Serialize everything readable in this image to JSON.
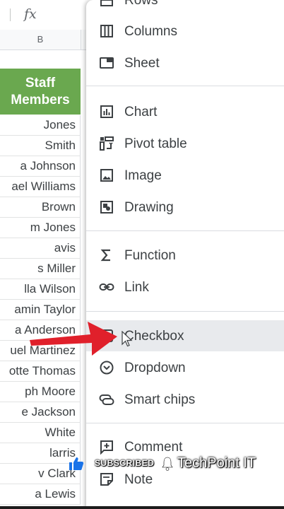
{
  "spreadsheet": {
    "column_header": "B",
    "header_cell": {
      "line1": "Staff",
      "line2": "Members"
    },
    "rows": [
      "Jones",
      "Smith",
      "a Johnson",
      "ael Williams",
      "Brown",
      "m Jones",
      "avis",
      "s Miller",
      "lla Wilson",
      "amin Taylor",
      "a Anderson",
      "uel Martinez",
      "otte Thomas",
      "ph Moore",
      "e Jackson",
      "White",
      "larris",
      "v Clark",
      "a Lewis"
    ],
    "header_color": "#6aa84f"
  },
  "menu": {
    "items": [
      {
        "label": "Rows",
        "icon": "rows-icon"
      },
      {
        "label": "Columns",
        "icon": "columns-icon"
      },
      {
        "label": "Sheet",
        "icon": "sheet-icon"
      },
      {
        "label": "Chart",
        "icon": "chart-icon"
      },
      {
        "label": "Pivot table",
        "icon": "pivot-table-icon"
      },
      {
        "label": "Image",
        "icon": "image-icon"
      },
      {
        "label": "Drawing",
        "icon": "drawing-icon"
      },
      {
        "label": "Function",
        "icon": "function-icon"
      },
      {
        "label": "Link",
        "icon": "link-icon"
      },
      {
        "label": "Checkbox",
        "icon": "checkbox-icon"
      },
      {
        "label": "Dropdown",
        "icon": "dropdown-icon"
      },
      {
        "label": "Smart chips",
        "icon": "smart-chips-icon"
      },
      {
        "label": "Comment",
        "icon": "comment-icon"
      },
      {
        "label": "Note",
        "icon": "note-icon"
      }
    ],
    "highlighted": "Checkbox"
  },
  "watermark": {
    "subscribed": "SUBSCRIBED",
    "channel": "TechPoint IT"
  },
  "colors": {
    "arrow": "#e0202b",
    "highlight": "#e8eaed"
  }
}
